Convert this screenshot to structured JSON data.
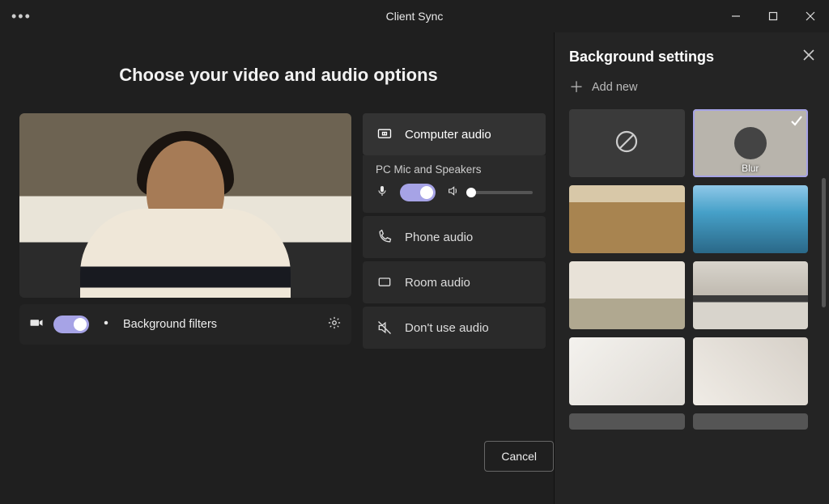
{
  "window": {
    "title": "Client Sync"
  },
  "main": {
    "heading": "Choose your video and audio options",
    "background_filters_label": "Background filters",
    "cancel_label": "Cancel"
  },
  "audio": {
    "computer_label": "Computer audio",
    "device_label": "PC Mic and Speakers",
    "phone_label": "Phone audio",
    "room_label": "Room audio",
    "none_label": "Don't use audio"
  },
  "sidebar": {
    "title": "Background settings",
    "add_new_label": "Add new",
    "blur_label": "Blur"
  }
}
